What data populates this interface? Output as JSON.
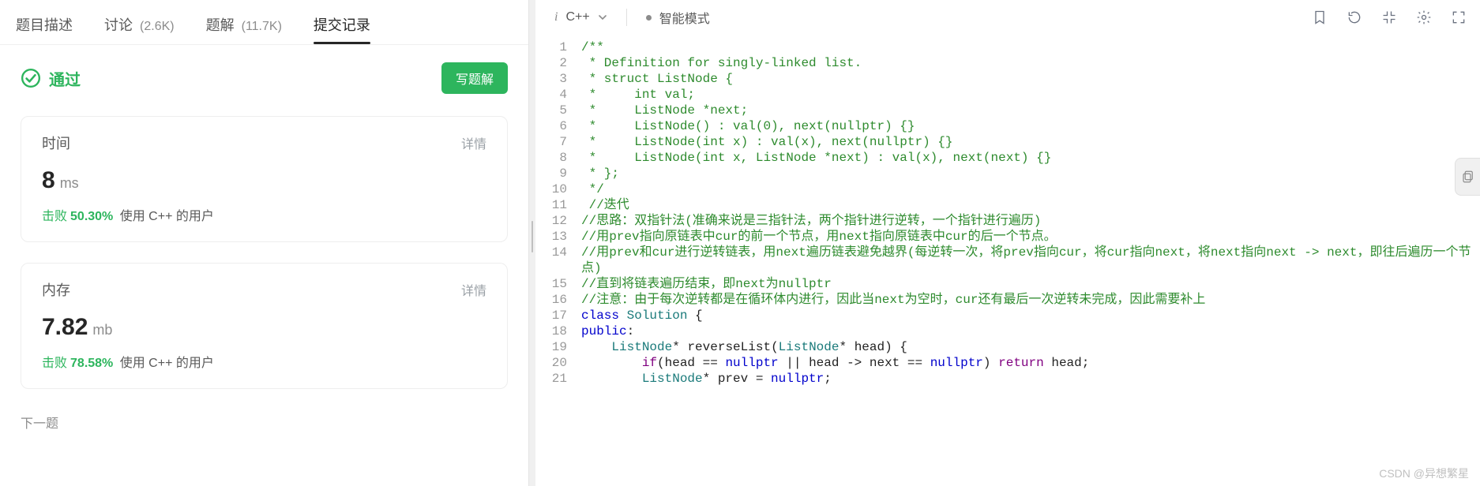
{
  "tabs": {
    "description": "题目描述",
    "discussion_label": "讨论",
    "discussion_count": "(2.6K)",
    "solution_label": "题解",
    "solution_count": "(11.7K)",
    "submissions": "提交记录"
  },
  "result": {
    "status": "通过",
    "write_solution": "写题解"
  },
  "time_card": {
    "title": "时间",
    "detail": "详情",
    "value": "8",
    "unit": "ms",
    "beats_prefix": "击败",
    "beats_pct": "50.30%",
    "beats_suffix": "使用 C++ 的用户"
  },
  "memory_card": {
    "title": "内存",
    "detail": "详情",
    "value": "7.82",
    "unit": "mb",
    "beats_prefix": "击败",
    "beats_pct": "78.58%",
    "beats_suffix": "使用 C++ 的用户"
  },
  "next_question": "下一题",
  "editor": {
    "language": "C++",
    "mode": "智能模式"
  },
  "code_lines": [
    {
      "n": 1,
      "html": "<span class='c-green'>/**</span>"
    },
    {
      "n": 2,
      "html": "<span class='c-green'> * Definition for singly-linked list.</span>"
    },
    {
      "n": 3,
      "html": "<span class='c-green'> * struct ListNode {</span>"
    },
    {
      "n": 4,
      "html": "<span class='c-green'> *     int val;</span>"
    },
    {
      "n": 5,
      "html": "<span class='c-green'> *     ListNode *next;</span>"
    },
    {
      "n": 6,
      "html": "<span class='c-green'> *     ListNode() : val(0), next(nullptr) {}</span>"
    },
    {
      "n": 7,
      "html": "<span class='c-green'> *     ListNode(int x) : val(x), next(nullptr) {}</span>"
    },
    {
      "n": 8,
      "html": "<span class='c-green'> *     ListNode(int x, ListNode *next) : val(x), next(next) {}</span>"
    },
    {
      "n": 9,
      "html": "<span class='c-green'> * };</span>"
    },
    {
      "n": 10,
      "html": "<span class='c-green'> */</span>"
    },
    {
      "n": 11,
      "html": "<span class='c-green'> //迭代</span>"
    },
    {
      "n": 12,
      "html": "<span class='c-green'>//思路：双指针法(准确来说是三指针法，两个指针进行逆转，一个指针进行遍历)</span>"
    },
    {
      "n": 13,
      "html": "<span class='c-green'>//用prev指向原链表中cur的前一个节点，用next指向原链表中cur的后一个节点。</span>"
    },
    {
      "n": 14,
      "html": "<span class='c-green'>//用prev和cur进行逆转链表，用next遍历链表避免越界(每逆转一次，将prev指向cur，将cur指向next，将next指向next -> next，即往后遍历一个节点)</span>",
      "wrap": true
    },
    {
      "n": 15,
      "html": "<span class='c-green'>//直到将链表遍历结束，即next为nullptr</span>"
    },
    {
      "n": 16,
      "html": "<span class='c-green'>//注意：由于每次逆转都是在循环体内进行，因此当next为空时，cur还有最后一次逆转未完成，因此需要补上</span>"
    },
    {
      "n": 17,
      "html": "<span class='c-blue'>class</span> <span class='c-teal'>Solution</span> <span class='c-black'>{</span>"
    },
    {
      "n": 18,
      "html": "<span class='c-blue'>public</span><span class='c-black'>:</span>"
    },
    {
      "n": 19,
      "html": "    <span class='c-teal'>ListNode</span><span class='c-black'>*</span> <span class='c-black'>reverseList</span><span class='c-black'>(</span><span class='c-teal'>ListNode</span><span class='c-black'>* head) {</span>"
    },
    {
      "n": 20,
      "html": "        <span class='c-purple'>if</span><span class='c-black'>(head == </span><span class='c-blue'>nullptr</span><span class='c-black'> || head -&gt; next == </span><span class='c-blue'>nullptr</span><span class='c-black'>)</span> <span class='c-purple'>return</span> <span class='c-black'>head;</span>"
    },
    {
      "n": 21,
      "html": "        <span class='c-teal'>ListNode</span><span class='c-black'>* prev = </span><span class='c-blue'>nullptr</span><span class='c-black'>;</span>"
    }
  ],
  "watermark": "CSDN @异想繁星"
}
